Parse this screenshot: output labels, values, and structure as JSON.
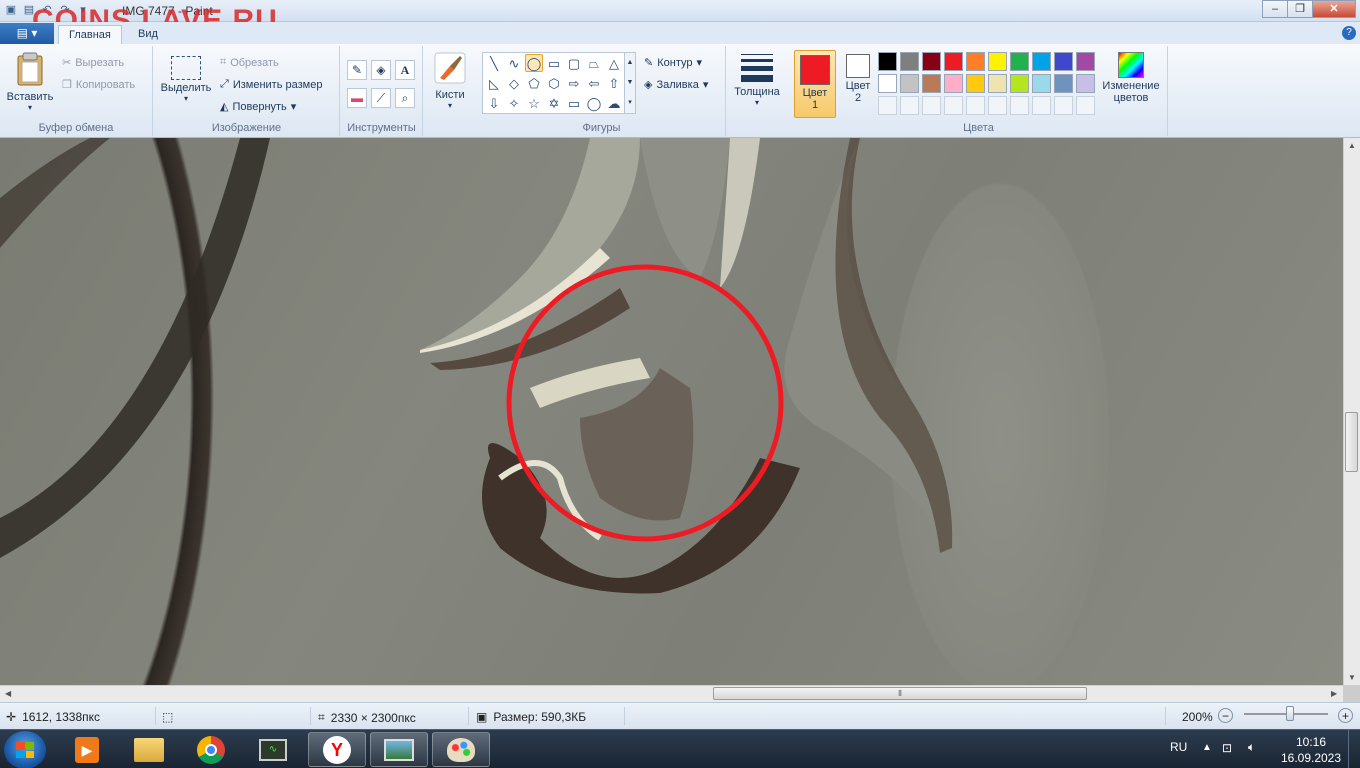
{
  "window": {
    "app_title": "IMG 7477 - Paint",
    "watermark": "COINS.LAVE.RU",
    "controls": [
      "–",
      "❐",
      "✕"
    ]
  },
  "tabs": {
    "file": "▤ ▾",
    "home": "Главная",
    "view": "Вид",
    "help": "?"
  },
  "ribbon": {
    "clipboard": {
      "group_label": "Буфер обмена",
      "paste": "Вставить",
      "cut": "Вырезать",
      "copy": "Копировать"
    },
    "image": {
      "group_label": "Изображение",
      "select": "Выделить",
      "crop": "Обрезать",
      "resize": "Изменить размер",
      "rotate": "Повернуть"
    },
    "tools": {
      "group_label": "Инструменты",
      "text_glyph": "A"
    },
    "brushes": {
      "label": "Кисти"
    },
    "shapes": {
      "group_label": "Фигуры",
      "outline": "Контур",
      "fill": "Заливка"
    },
    "size": {
      "label": "Толщина"
    },
    "colors": {
      "group_label": "Цвета",
      "color1_line1": "Цвет",
      "color1_line2": "1",
      "color2_line1": "Цвет",
      "color2_line2": "2",
      "edit_line1": "Изменение",
      "edit_line2": "цветов",
      "color1": "#ed1c24",
      "color2": "#ffffff",
      "palette_row1": [
        "#000000",
        "#7f7f7f",
        "#880015",
        "#ed1c24",
        "#ff7f27",
        "#fff200",
        "#22b14c",
        "#00a2e8",
        "#3f48cc",
        "#a349a4"
      ],
      "palette_row2": [
        "#ffffff",
        "#c3c3c3",
        "#b97a57",
        "#ffaec9",
        "#ffc90e",
        "#efe4b0",
        "#b5e61d",
        "#99d9ea",
        "#7092be",
        "#c8bfe7"
      ]
    }
  },
  "status": {
    "cursor_pos": "1612, 1338пкс",
    "image_size": "2330 × 2300пкс",
    "file_size": "Размер: 590,3КБ",
    "zoom": "200%",
    "zoom_fraction": 0.55
  },
  "taskbar": {
    "lang": "RU",
    "time": "10:16",
    "date": "16.09.2023"
  }
}
